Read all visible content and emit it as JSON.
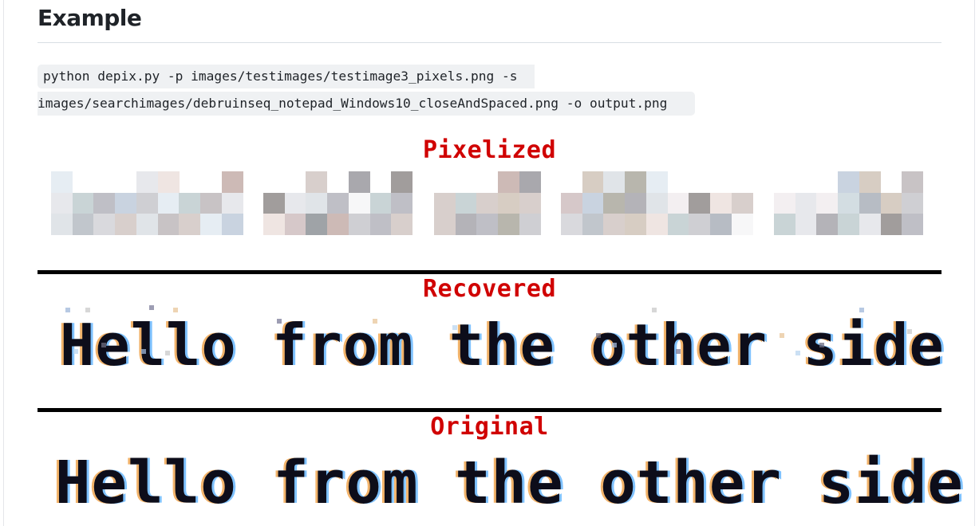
{
  "section": {
    "heading": "Example"
  },
  "command": {
    "line1": "python depix.py -p images/testimages/testimage3_pixels.png -s",
    "line2": "images/searchimages/debruinseq_notepad_Windows10_closeAndSpaced.png -o output.png"
  },
  "figure": {
    "pixelized_label": "Pixelized",
    "recovered_label": "Recovered",
    "original_label": "Original",
    "recovered_text": "Hello from the other side",
    "original_text": "Hello from the other side",
    "label_color": "#d00000"
  }
}
